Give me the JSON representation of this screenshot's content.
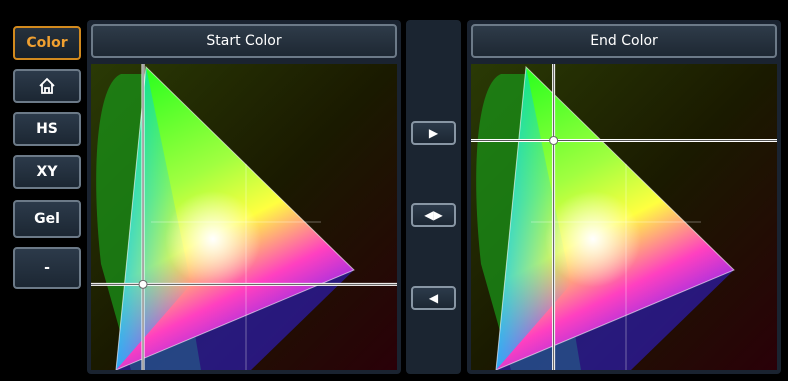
{
  "sidebar": {
    "color_label": "Color",
    "home_icon": "home-icon",
    "hs_label": "HS",
    "xy_label": "XY",
    "gel_label": "Gel",
    "dash_label": "-"
  },
  "start_panel": {
    "title": "Start Color",
    "crosshair": {
      "x": 0.17,
      "y": 0.72
    }
  },
  "end_panel": {
    "title": "End Color",
    "crosshair": {
      "x": 0.27,
      "y": 0.25
    }
  },
  "transfer": {
    "right_glyph": "▶",
    "both_glyph": "◀▶",
    "left_glyph": "◀"
  },
  "colors": {
    "accent": "#d28a1e",
    "border": "#6c7a88",
    "panel": "#1a2330"
  }
}
